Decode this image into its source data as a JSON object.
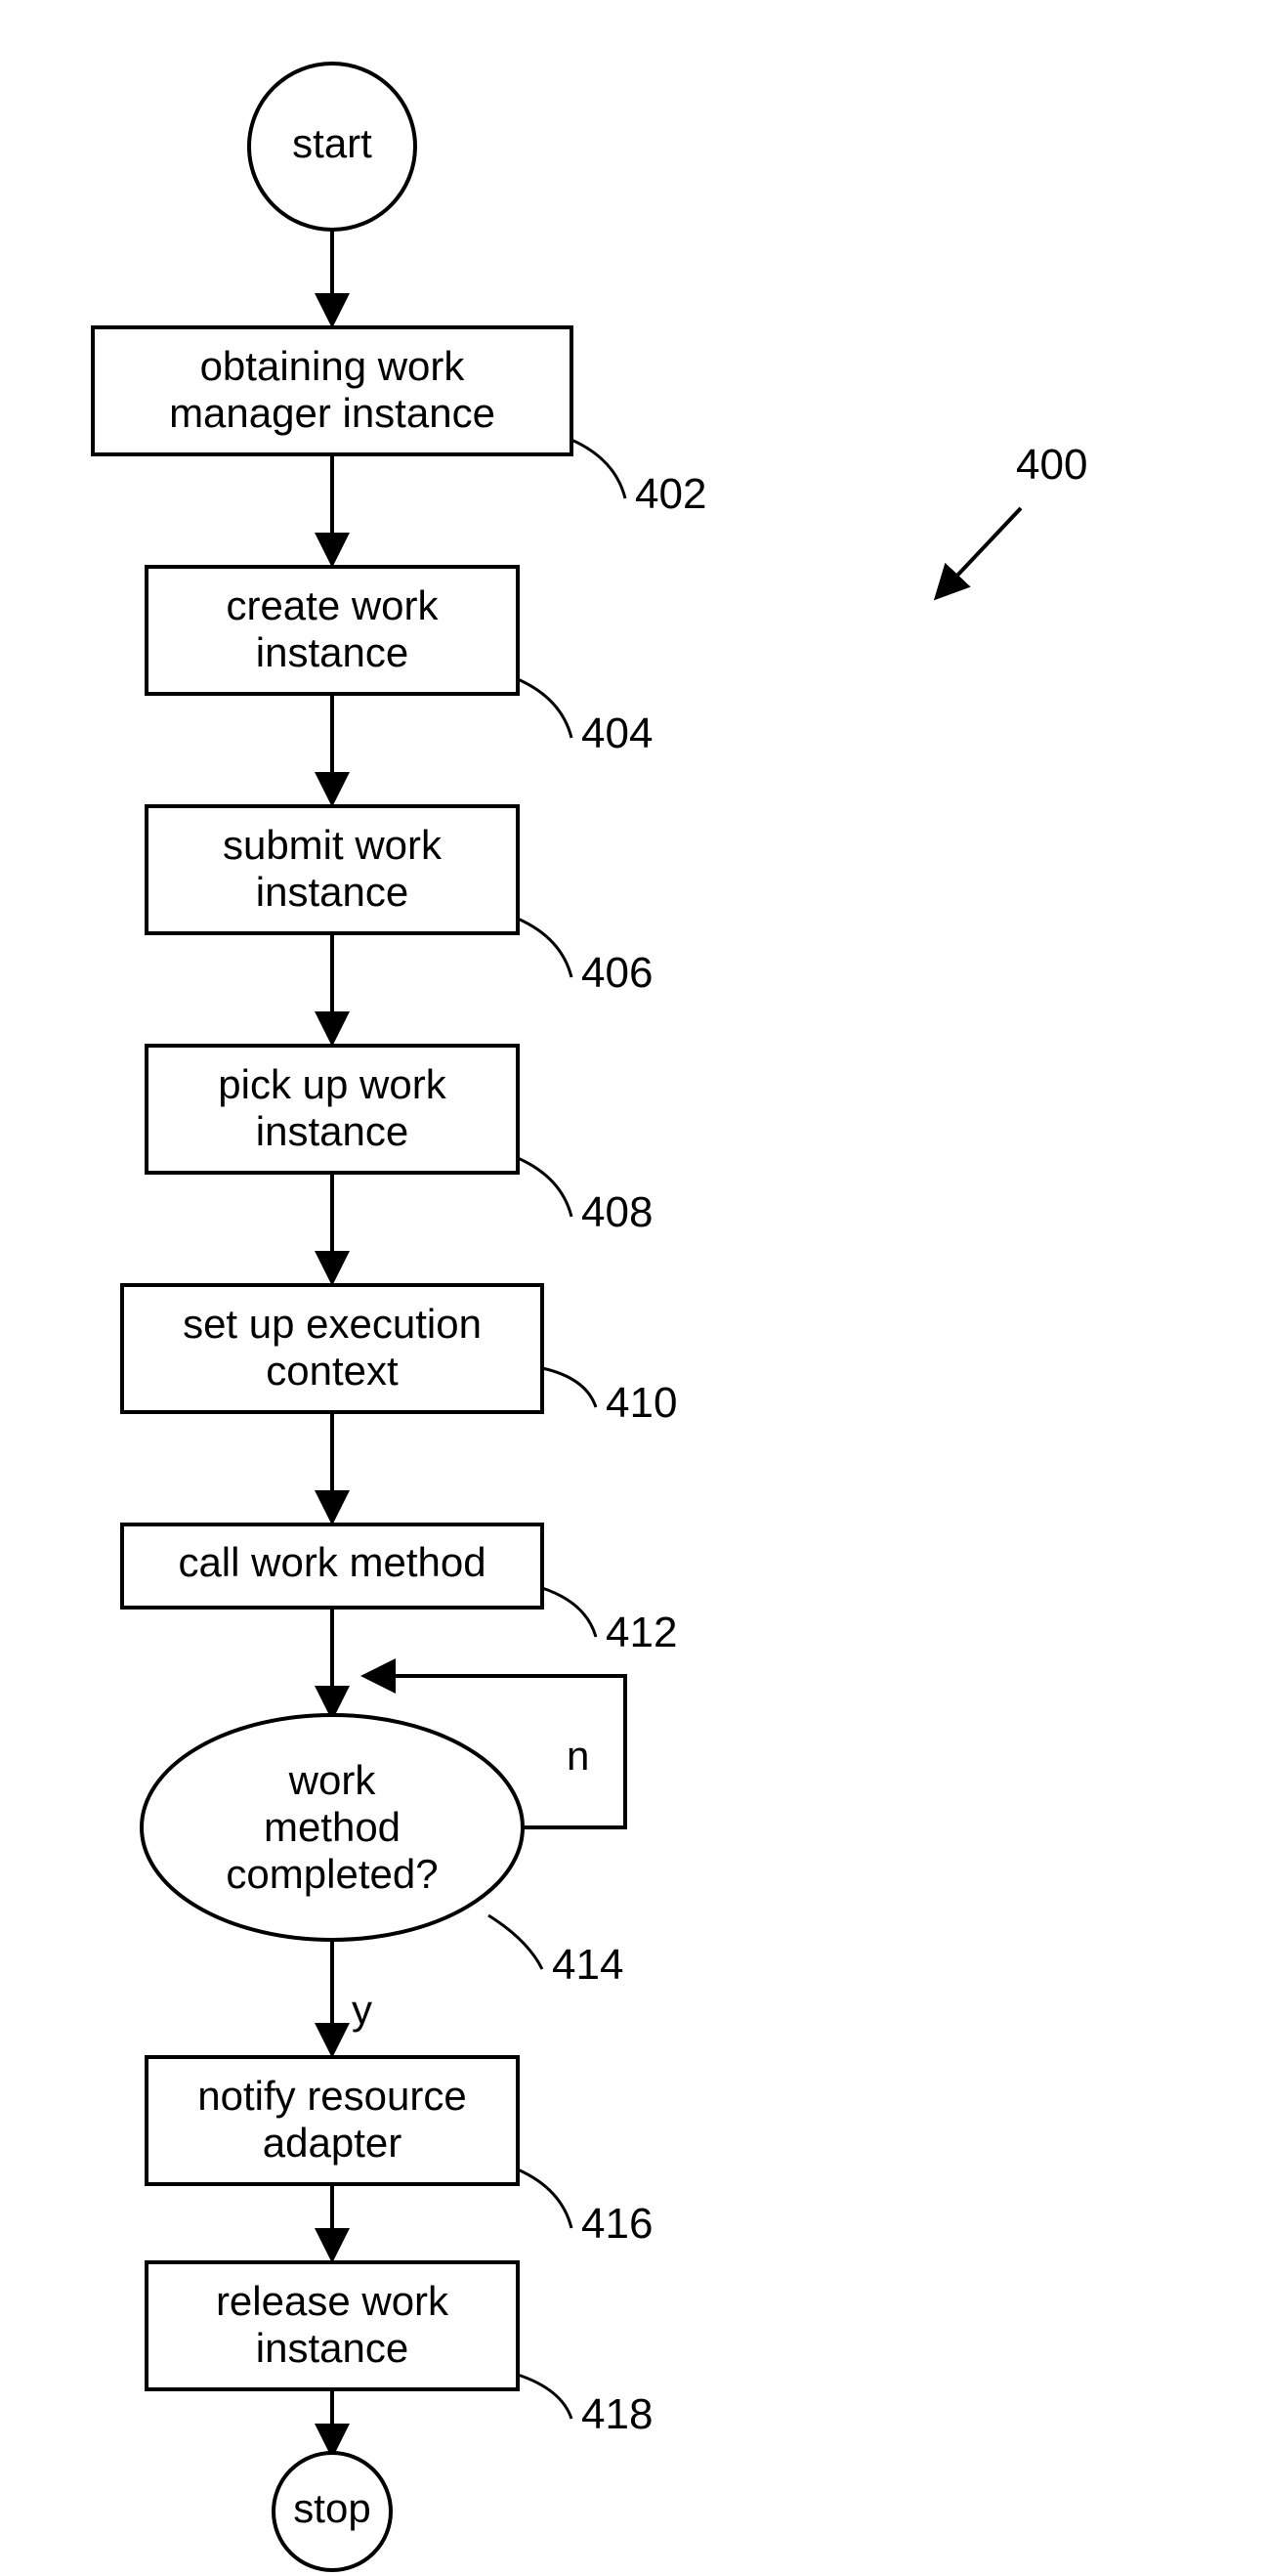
{
  "diagram": {
    "figure_ref": "400",
    "start": "start",
    "stop": "stop",
    "steps": [
      {
        "id": "402",
        "text_lines": [
          "obtaining work",
          "manager instance"
        ]
      },
      {
        "id": "404",
        "text_lines": [
          "create work",
          "instance"
        ]
      },
      {
        "id": "406",
        "text_lines": [
          "submit work",
          "instance"
        ]
      },
      {
        "id": "408",
        "text_lines": [
          "pick up work",
          "instance"
        ]
      },
      {
        "id": "410",
        "text_lines": [
          "set up execution",
          "context"
        ]
      },
      {
        "id": "412",
        "text_lines": [
          "call work method"
        ]
      }
    ],
    "decision": {
      "id": "414",
      "text_lines": [
        "work",
        "method",
        "completed?"
      ],
      "no_label": "n",
      "yes_label": "y"
    },
    "post_steps": [
      {
        "id": "416",
        "text_lines": [
          "notify resource",
          "adapter"
        ]
      },
      {
        "id": "418",
        "text_lines": [
          "release work",
          "instance"
        ]
      }
    ]
  },
  "chart_data": {
    "type": "flowchart",
    "nodes": [
      {
        "id": "start",
        "shape": "oval",
        "label": "start"
      },
      {
        "id": "402",
        "shape": "rect",
        "label": "obtaining work manager instance"
      },
      {
        "id": "404",
        "shape": "rect",
        "label": "create work instance"
      },
      {
        "id": "406",
        "shape": "rect",
        "label": "submit work instance"
      },
      {
        "id": "408",
        "shape": "rect",
        "label": "pick up work instance"
      },
      {
        "id": "410",
        "shape": "rect",
        "label": "set up execution context"
      },
      {
        "id": "412",
        "shape": "rect",
        "label": "call work method"
      },
      {
        "id": "414",
        "shape": "oval-decision",
        "label": "work method completed?"
      },
      {
        "id": "416",
        "shape": "rect",
        "label": "notify resource adapter"
      },
      {
        "id": "418",
        "shape": "rect",
        "label": "release work instance"
      },
      {
        "id": "stop",
        "shape": "oval",
        "label": "stop"
      }
    ],
    "edges": [
      {
        "from": "start",
        "to": "402"
      },
      {
        "from": "402",
        "to": "404"
      },
      {
        "from": "404",
        "to": "406"
      },
      {
        "from": "406",
        "to": "408"
      },
      {
        "from": "408",
        "to": "410"
      },
      {
        "from": "410",
        "to": "412"
      },
      {
        "from": "412",
        "to": "414"
      },
      {
        "from": "414",
        "to": "414",
        "label": "n"
      },
      {
        "from": "414",
        "to": "416",
        "label": "y"
      },
      {
        "from": "416",
        "to": "418"
      },
      {
        "from": "418",
        "to": "stop"
      }
    ],
    "figure_reference": "400"
  }
}
